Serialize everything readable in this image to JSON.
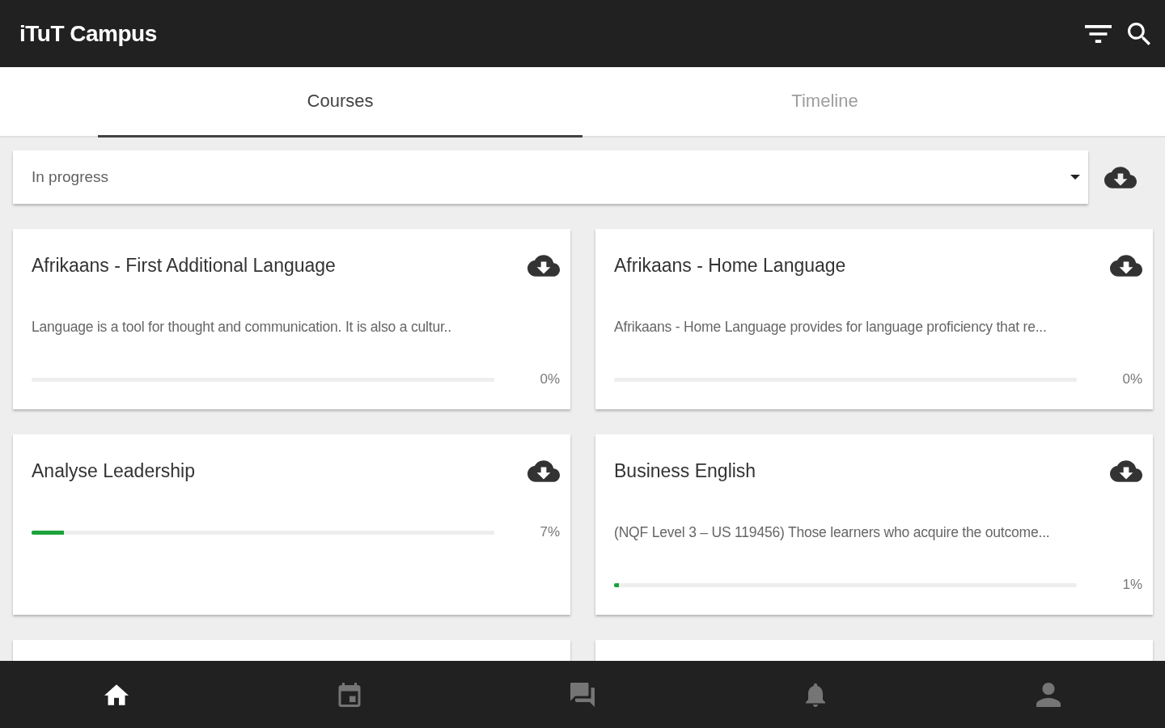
{
  "app_bar": {
    "title": "iTuT Campus"
  },
  "tabs": [
    {
      "label": "Courses",
      "selected": true
    },
    {
      "label": "Timeline",
      "selected": false
    }
  ],
  "filter": {
    "value": "In progress"
  },
  "courses": [
    {
      "title": "Afrikaans - First Additional Language",
      "description": "Language is a tool for thought and communication. It is also a cultur..",
      "level": 0,
      "percent": "0%"
    },
    {
      "title": "Afrikaans - Home Language",
      "description": "Afrikaans - Home Language provides for language proficiency that re...",
      "level": 0,
      "percent": "0%"
    },
    {
      "title": "Analyse Leadership",
      "level": 0.07,
      "percent": "7%"
    },
    {
      "title": "Business English",
      "description": "(NQF Level 3 – US 119456) Those learners who acquire the outcome...",
      "level": 0.01,
      "percent": "1%"
    }
  ],
  "bottom_nav": [
    {
      "kind": "home",
      "selected": true
    },
    {
      "kind": "calendar",
      "selected": false
    },
    {
      "kind": "forum",
      "selected": false
    },
    {
      "kind": "bell",
      "selected": false
    },
    {
      "kind": "person",
      "selected": false
    }
  ]
}
